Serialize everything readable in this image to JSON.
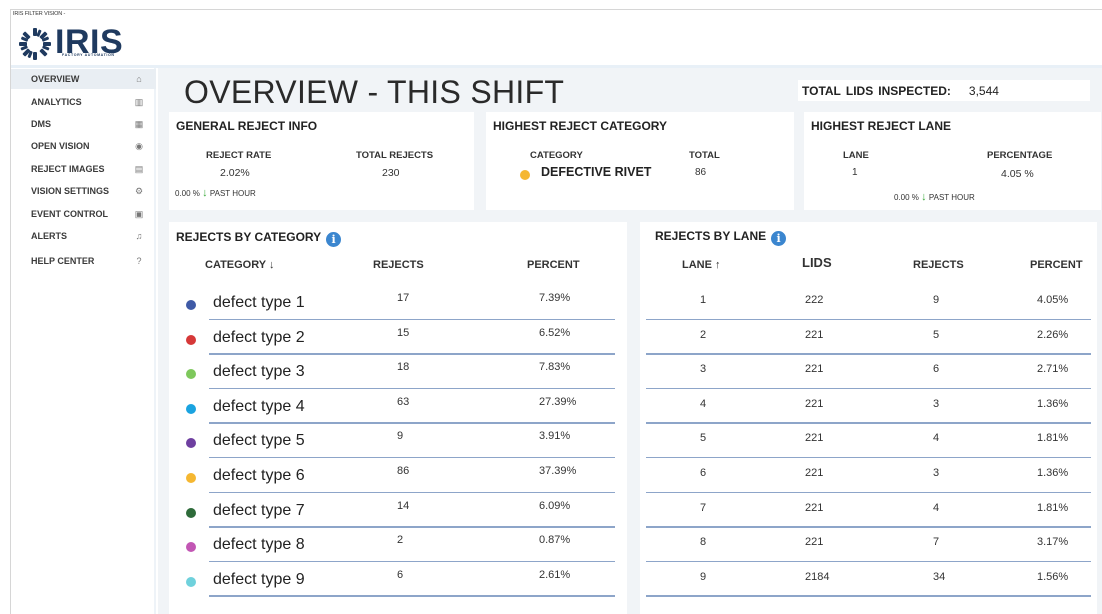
{
  "app": {
    "caption": "IRIS FILTER VISION -",
    "logo_text": "IRIS",
    "logo_sub": "FACTORY AUTOMATION"
  },
  "sidebar": {
    "items": [
      {
        "label": "OVERVIEW",
        "icon": "home-icon",
        "glyph": "⌂"
      },
      {
        "label": "ANALYTICS",
        "icon": "analytics-icon",
        "glyph": "▥"
      },
      {
        "label": "DMS",
        "icon": "grid-icon",
        "glyph": "▦"
      },
      {
        "label": "OPEN VISION",
        "icon": "eye-icon",
        "glyph": "◉"
      },
      {
        "label": "REJECT IMAGES",
        "icon": "file-icon",
        "glyph": "▤"
      },
      {
        "label": "VISION SETTINGS",
        "icon": "gear-icon",
        "glyph": "⚙"
      },
      {
        "label": "EVENT CONTROL",
        "icon": "calendar-icon",
        "glyph": "▣"
      },
      {
        "label": "ALERTS",
        "icon": "bell-icon",
        "glyph": "♫"
      },
      {
        "label": "HELP CENTER",
        "icon": "help-icon",
        "glyph": "?"
      }
    ]
  },
  "header": {
    "title": "OVERVIEW - THIS SHIFT",
    "total_label_1": "TOTAL",
    "total_label_lids": "LIDS",
    "total_label_2": "INSPECTED:",
    "total_value": "3,544"
  },
  "general": {
    "title": "GENERAL REJECT INFO",
    "reject_rate_label": "REJECT RATE",
    "reject_rate_value": "2.02%",
    "total_rejects_label": "TOTAL REJECTS",
    "total_rejects_value": "230",
    "delta": "0.00 %",
    "delta_label": "PAST HOUR"
  },
  "highest_category": {
    "title": "HIGHEST REJECT CATEGORY",
    "category_label": "CATEGORY",
    "category_value": "DEFECTIVE RIVET",
    "category_color": "#f5b731",
    "total_label": "TOTAL",
    "total_value": "86"
  },
  "highest_lane": {
    "title": "HIGHEST REJECT LANE",
    "lane_label": "LANE",
    "lane_value": "1",
    "percentage_label": "PERCENTAGE",
    "percentage_value": "4.05 %",
    "delta": "0.00 %",
    "delta_label": "PAST HOUR"
  },
  "by_category": {
    "title": "REJECTS BY CATEGORY",
    "headers": {
      "category": "CATEGORY",
      "category_sort": "↓",
      "rejects": "REJECTS",
      "percent": "PERCENT"
    },
    "rows": [
      {
        "name": "defect type 1",
        "color": "#3f5aa6",
        "rejects": "17",
        "percent": "7.39%"
      },
      {
        "name": "defect type 2",
        "color": "#d63838",
        "rejects": "15",
        "percent": "6.52%"
      },
      {
        "name": "defect type 3",
        "color": "#7ec85c",
        "rejects": "18",
        "percent": "7.83%"
      },
      {
        "name": "defect type 4",
        "color": "#1aa3e0",
        "rejects": "63",
        "percent": "27.39%"
      },
      {
        "name": "defect type 5",
        "color": "#6e3fa0",
        "rejects": "9",
        "percent": "3.91%"
      },
      {
        "name": "defect type 6",
        "color": "#f5b731",
        "rejects": "86",
        "percent": "37.39%"
      },
      {
        "name": "defect type 7",
        "color": "#2e6b3a",
        "rejects": "14",
        "percent": "6.09%"
      },
      {
        "name": "defect type 8",
        "color": "#c256b4",
        "rejects": "2",
        "percent": "0.87%"
      },
      {
        "name": "defect type 9",
        "color": "#6fd1dc",
        "rejects": "6",
        "percent": "2.61%"
      }
    ]
  },
  "by_lane": {
    "title": "REJECTS BY LANE",
    "headers": {
      "lane": "LANE",
      "lane_sort": "↑",
      "lids": "LIDS",
      "rejects": "REJECTS",
      "percent": "PERCENT"
    },
    "rows": [
      {
        "lane": "1",
        "lids": "222",
        "rejects": "9",
        "percent": "4.05%"
      },
      {
        "lane": "2",
        "lids": "221",
        "rejects": "5",
        "percent": "2.26%"
      },
      {
        "lane": "3",
        "lids": "221",
        "rejects": "6",
        "percent": "2.71%"
      },
      {
        "lane": "4",
        "lids": "221",
        "rejects": "3",
        "percent": "1.36%"
      },
      {
        "lane": "5",
        "lids": "221",
        "rejects": "4",
        "percent": "1.81%"
      },
      {
        "lane": "6",
        "lids": "221",
        "rejects": "3",
        "percent": "1.36%"
      },
      {
        "lane": "7",
        "lids": "221",
        "rejects": "4",
        "percent": "1.81%"
      },
      {
        "lane": "8",
        "lids": "221",
        "rejects": "7",
        "percent": "3.17%"
      },
      {
        "lane": "9",
        "lids": "2184",
        "rejects": "34",
        "percent": "1.56%"
      }
    ]
  }
}
